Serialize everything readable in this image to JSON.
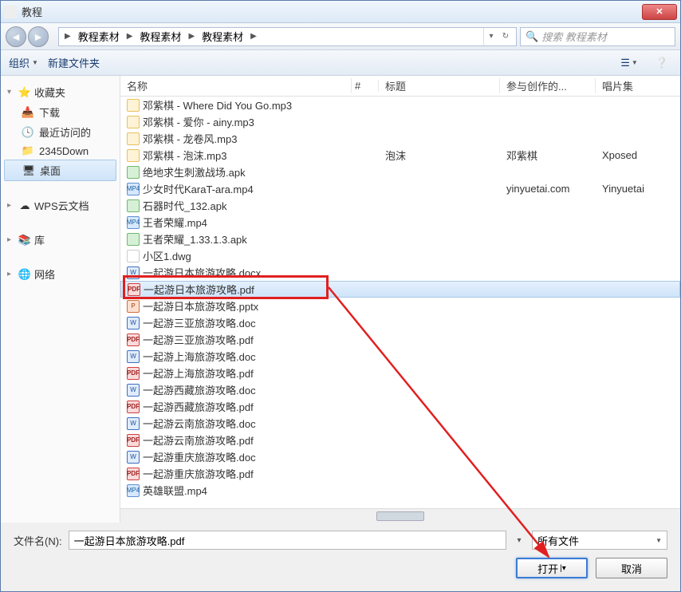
{
  "title": "教程",
  "breadcrumb": [
    "教程素材",
    "教程素材",
    "教程素材"
  ],
  "search_placeholder": "搜索 教程素材",
  "toolbar": {
    "organize": "组织",
    "newfolder": "新建文件夹"
  },
  "sidebar": {
    "favorites": {
      "label": "收藏夹",
      "items": [
        "下载",
        "最近访问的",
        "2345Down",
        "桌面"
      ]
    },
    "wps": {
      "label": "WPS云文档"
    },
    "library": {
      "label": "库"
    },
    "network": {
      "label": "网络"
    }
  },
  "columns": {
    "name": "名称",
    "num": "#",
    "title": "标题",
    "artist": "参与创作的...",
    "album": "唱片集"
  },
  "files": [
    {
      "icon": "mp3",
      "name": "邓紫棋 - Where Did You Go.mp3"
    },
    {
      "icon": "mp3",
      "name": "邓紫棋 - 爱你 - ainy.mp3"
    },
    {
      "icon": "mp3",
      "name": "邓紫棋 - 龙卷风.mp3"
    },
    {
      "icon": "mp3",
      "name": "邓紫棋 - 泡沫.mp3",
      "title": "泡沫",
      "artist": "邓紫棋",
      "album": "Xposed"
    },
    {
      "icon": "apk",
      "name": "绝地求生刺激战场.apk"
    },
    {
      "icon": "mp4",
      "name": "少女时代KaraT-ara.mp4",
      "artist": "yinyuetai.com",
      "album": "Yinyuetai"
    },
    {
      "icon": "apk",
      "name": "石器时代_132.apk"
    },
    {
      "icon": "mp4",
      "name": "王者荣耀.mp4"
    },
    {
      "icon": "apk",
      "name": "王者荣耀_1.33.1.3.apk"
    },
    {
      "icon": "dwg",
      "name": "小区1.dwg"
    },
    {
      "icon": "doc",
      "name": "一起游日本旅游攻略.docx"
    },
    {
      "icon": "pdf",
      "name": "一起游日本旅游攻略.pdf",
      "selected": true
    },
    {
      "icon": "ppt",
      "name": "一起游日本旅游攻略.pptx"
    },
    {
      "icon": "doc",
      "name": "一起游三亚旅游攻略.doc"
    },
    {
      "icon": "pdf",
      "name": "一起游三亚旅游攻略.pdf"
    },
    {
      "icon": "doc",
      "name": "一起游上海旅游攻略.doc"
    },
    {
      "icon": "pdf",
      "name": "一起游上海旅游攻略.pdf"
    },
    {
      "icon": "doc",
      "name": "一起游西藏旅游攻略.doc"
    },
    {
      "icon": "pdf",
      "name": "一起游西藏旅游攻略.pdf"
    },
    {
      "icon": "doc",
      "name": "一起游云南旅游攻略.doc"
    },
    {
      "icon": "pdf",
      "name": "一起游云南旅游攻略.pdf"
    },
    {
      "icon": "doc",
      "name": "一起游重庆旅游攻略.doc"
    },
    {
      "icon": "pdf",
      "name": "一起游重庆旅游攻略.pdf"
    },
    {
      "icon": "mp4",
      "name": "英雄联盟.mp4"
    }
  ],
  "filename_label": "文件名(N):",
  "filename_value": "一起游日本旅游攻略.pdf",
  "filter_value": "所有文件",
  "open_label": "打开",
  "cancel_label": "取消",
  "icon_text": {
    "mp4": "MP4",
    "pdf": "PDF",
    "doc": "W",
    "ppt": "P"
  }
}
